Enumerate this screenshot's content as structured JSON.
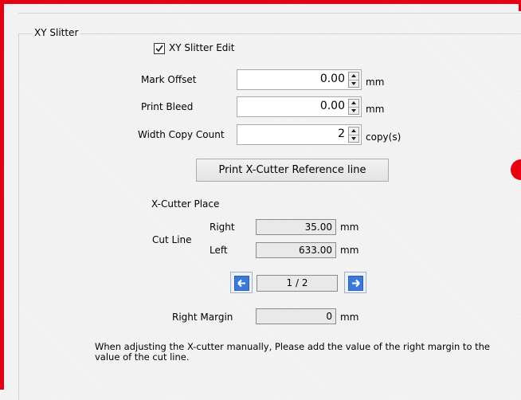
{
  "group": {
    "title": "XY Slitter"
  },
  "edit_checkbox": {
    "label": "XY Slitter Edit",
    "checked": true
  },
  "mark_offset": {
    "label": "Mark Offset",
    "value": "0.00",
    "unit": "mm"
  },
  "print_bleed": {
    "label": "Print Bleed",
    "value": "0.00",
    "unit": "mm"
  },
  "width_copy": {
    "label": "Width Copy Count",
    "value": "2",
    "unit": "copy(s)"
  },
  "print_button": {
    "label": "Print X-Cutter Reference line"
  },
  "xcutter": {
    "title": "X-Cutter Place",
    "cut_line_label": "Cut Line",
    "right_label": "Right",
    "right_value": "35.00",
    "left_label": "Left",
    "left_value": "633.00",
    "unit": "mm"
  },
  "pager": {
    "text": "1 / 2"
  },
  "right_margin": {
    "label": "Right Margin",
    "value": "0",
    "unit": "mm"
  },
  "note": "When adjusting the X-cutter manually, Please add the value of the right margin to the value of the cut line.",
  "colors": {
    "accent_red": "#e60012",
    "nav_blue": "#3c78d8"
  }
}
